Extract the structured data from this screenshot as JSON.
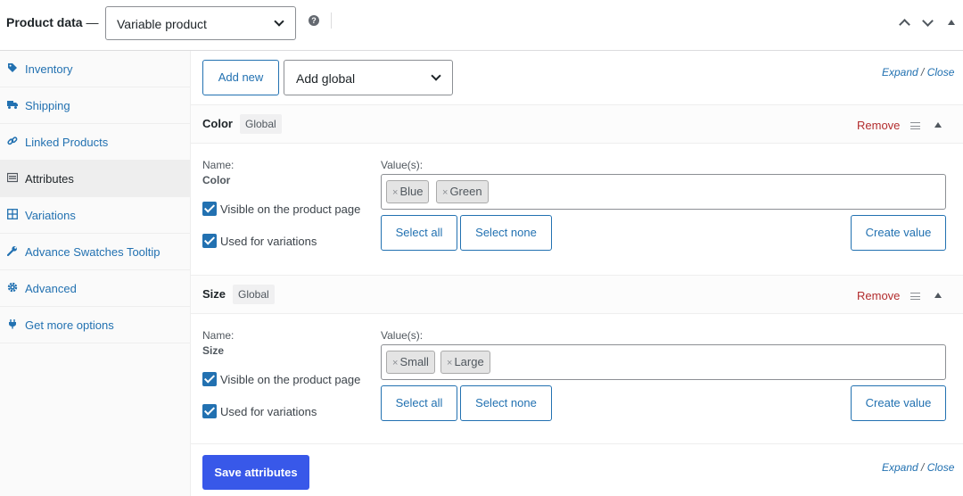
{
  "header": {
    "title": "Product data",
    "dash": " —",
    "product_type": "Variable product",
    "help": "?"
  },
  "sidebar": {
    "items": [
      {
        "label": "Inventory",
        "icon": "tag-icon"
      },
      {
        "label": "Shipping",
        "icon": "truck-icon"
      },
      {
        "label": "Linked Products",
        "icon": "link-icon"
      },
      {
        "label": "Attributes",
        "icon": "list-table-icon"
      },
      {
        "label": "Variations",
        "icon": "grid-icon"
      },
      {
        "label": "Advance Swatches Tooltip",
        "icon": "wrench-icon"
      },
      {
        "label": "Advanced",
        "icon": "gear-icon"
      },
      {
        "label": "Get more options",
        "icon": "plugin-icon"
      }
    ]
  },
  "toolbar": {
    "add_new": "Add new",
    "add_global": "Add global",
    "expand": "Expand",
    "slash": " / ",
    "close": "Close"
  },
  "attributes": [
    {
      "name": "Color",
      "badge": "Global",
      "remove": "Remove",
      "name_label": "Name:",
      "name_value": "Color",
      "values_label": "Value(s):",
      "values": [
        "Blue",
        "Green"
      ],
      "visible": "Visible on the product page",
      "used": "Used for variations",
      "select_all": "Select all",
      "select_none": "Select none",
      "create_value": "Create value"
    },
    {
      "name": "Size",
      "badge": "Global",
      "remove": "Remove",
      "name_label": "Name:",
      "name_value": "Size",
      "values_label": "Value(s):",
      "values": [
        "Small",
        "Large"
      ],
      "visible": "Visible on the product page",
      "used": "Used for variations",
      "select_all": "Select all",
      "select_none": "Select none",
      "create_value": "Create value"
    }
  ],
  "footer": {
    "save": "Save attributes",
    "expand": "Expand",
    "slash": " / ",
    "close": "Close"
  },
  "chip_remove": "×",
  "colors": {
    "accent": "#2271b1",
    "primary_button": "#3858e9",
    "remove": "#b32d2e"
  }
}
